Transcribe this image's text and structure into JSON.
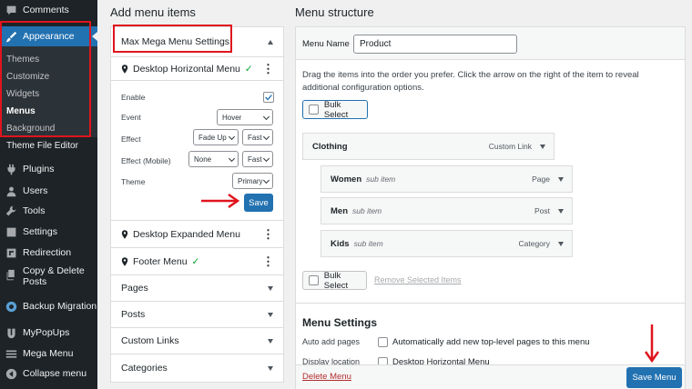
{
  "sidebar": {
    "top_items": [
      {
        "label": "Comments",
        "icon": "comment-icon"
      },
      {
        "label": "Appearance",
        "icon": "paintbrush-icon"
      }
    ],
    "submenu": [
      "Themes",
      "Customize",
      "Widgets",
      "Menus",
      "Background"
    ],
    "current_submenu": "Menus",
    "items": [
      {
        "label": "Theme File Editor",
        "icon": ""
      },
      {
        "label": "Plugins",
        "icon": "plugin-icon"
      },
      {
        "label": "Users",
        "icon": "users-icon"
      },
      {
        "label": "Tools",
        "icon": "tools-icon"
      },
      {
        "label": "Settings",
        "icon": "settings-icon"
      },
      {
        "label": "Redirection",
        "icon": "redirection-icon"
      },
      {
        "label": "Copy & Delete Posts",
        "icon": "copy-icon"
      },
      {
        "label": "Backup Migration",
        "icon": "backup-icon"
      },
      {
        "label": "MyPopUps",
        "icon": "popup-icon"
      },
      {
        "label": "Mega Menu",
        "icon": "megamenu-icon"
      },
      {
        "label": "Collapse menu",
        "icon": "collapse-icon"
      }
    ],
    "accent": "#2271b1"
  },
  "add_items": {
    "title": "Add menu items",
    "mega_section_title": "Max Mega Menu Settings",
    "locations": [
      {
        "label": "Desktop Horizontal Menu",
        "check": "✓"
      },
      {
        "label": "Desktop Expanded Menu",
        "check": ""
      },
      {
        "label": "Footer Menu",
        "check": "✓"
      }
    ],
    "settings": {
      "enable_label": "Enable",
      "event_label": "Event",
      "event_value": "Hover",
      "effect_label": "Effect",
      "effect_value": "Fade Up",
      "effect_speed": "Fast",
      "effect_mobile_label": "Effect (Mobile)",
      "effect_mobile_value": "None",
      "effect_mobile_speed": "Fast",
      "theme_label": "Theme",
      "theme_value": "Primary",
      "save_label": "Save"
    },
    "sections": [
      "Pages",
      "Posts",
      "Custom Links",
      "Categories"
    ]
  },
  "structure": {
    "title": "Menu structure",
    "menu_name_label": "Menu Name",
    "menu_name_value": "Product",
    "instructions": "Drag the items into the order you prefer. Click the arrow on the right of the item to reveal additional configuration options.",
    "bulk_select": "Bulk Select",
    "items": [
      {
        "title": "Clothing",
        "sub": "",
        "type": "Custom Link"
      },
      {
        "title": "Women",
        "sub": "sub item",
        "type": "Page"
      },
      {
        "title": "Men",
        "sub": "sub item",
        "type": "Post"
      },
      {
        "title": "Kids",
        "sub": "sub item",
        "type": "Category"
      }
    ],
    "remove_selected": "Remove Selected Items",
    "menu_settings_title": "Menu Settings",
    "auto_add_label": "Auto add pages",
    "auto_add_text": "Automatically add new top-level pages to this menu",
    "display_location_label": "Display location",
    "display_location_text": "Desktop Horizontal Menu",
    "delete_menu": "Delete Menu",
    "save_menu": "Save Menu"
  }
}
